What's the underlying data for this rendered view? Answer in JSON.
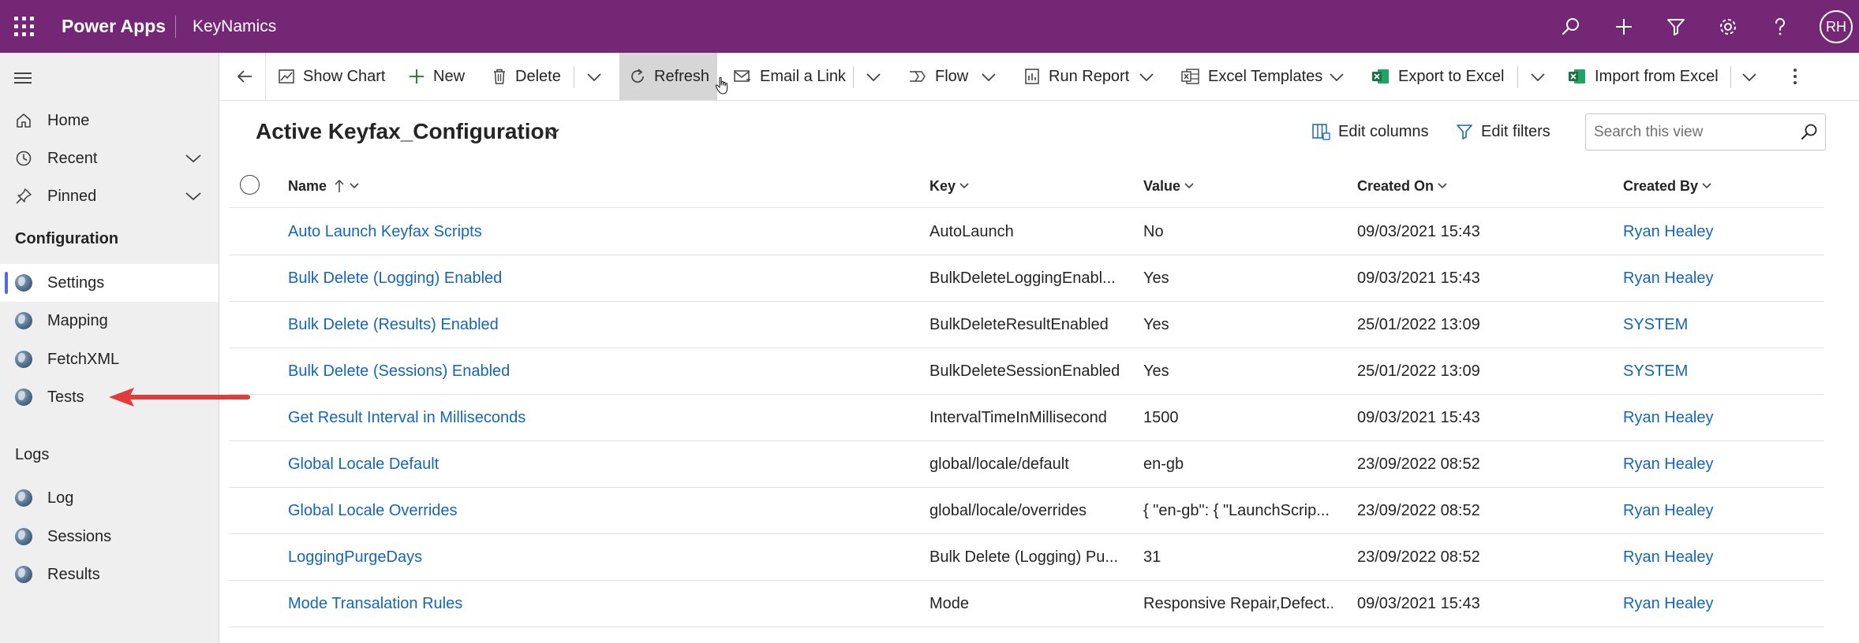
{
  "topbar": {
    "brand": "Power Apps",
    "app_name": "KeyNamics",
    "icons": [
      "search-icon",
      "plus-icon",
      "filter-icon",
      "settings-gear-icon",
      "help-icon"
    ],
    "avatar_initials": "RH"
  },
  "sidebar": {
    "items_top": [
      {
        "label": "Home",
        "icon": "home-icon"
      },
      {
        "label": "Recent",
        "icon": "clock-icon",
        "expandable": true
      },
      {
        "label": "Pinned",
        "icon": "pin-icon",
        "expandable": true
      }
    ],
    "section_configuration": "Configuration",
    "configuration_items": [
      {
        "label": "Settings",
        "icon": "entity-globe-icon",
        "active": true
      },
      {
        "label": "Mapping",
        "icon": "entity-globe-icon"
      },
      {
        "label": "FetchXML",
        "icon": "entity-globe-icon"
      },
      {
        "label": "Tests",
        "icon": "entity-globe-icon"
      }
    ],
    "section_logs": "Logs",
    "logs_items": [
      {
        "label": "Log",
        "icon": "entity-globe-icon"
      },
      {
        "label": "Sessions",
        "icon": "entity-globe-icon"
      },
      {
        "label": "Results",
        "icon": "entity-globe-icon"
      }
    ],
    "annotation_arrow_color": "#e03c3c"
  },
  "commandbar": {
    "show_chart": "Show Chart",
    "new": "New",
    "delete": "Delete",
    "refresh": "Refresh",
    "email_link": "Email a Link",
    "flow": "Flow",
    "run_report": "Run Report",
    "excel_templates": "Excel Templates",
    "export_excel": "Export to Excel",
    "import_excel": "Import from Excel"
  },
  "view": {
    "title": "Active Keyfax_Configuration",
    "edit_columns": "Edit columns",
    "edit_filters": "Edit filters",
    "search_placeholder": "Search this view"
  },
  "grid": {
    "columns": [
      "Name",
      "Key",
      "Value",
      "Created On",
      "Created By"
    ],
    "sorted_column": "Name",
    "rows": [
      {
        "name": "Auto Launch Keyfax Scripts",
        "key": "AutoLaunch",
        "value": "No",
        "created_on": "09/03/2021 15:43",
        "created_by": "Ryan Healey"
      },
      {
        "name": "Bulk Delete (Logging) Enabled",
        "key": "BulkDeleteLoggingEnabl...",
        "value": "Yes",
        "created_on": "09/03/2021 15:43",
        "created_by": "Ryan Healey"
      },
      {
        "name": "Bulk Delete (Results) Enabled",
        "key": "BulkDeleteResultEnabled",
        "value": "Yes",
        "created_on": "25/01/2022 13:09",
        "created_by": "SYSTEM"
      },
      {
        "name": "Bulk Delete (Sessions) Enabled",
        "key": "BulkDeleteSessionEnabled",
        "value": "Yes",
        "created_on": "25/01/2022 13:09",
        "created_by": "SYSTEM"
      },
      {
        "name": "Get Result Interval in Milliseconds",
        "key": "IntervalTimeInMillisecond",
        "value": "1500",
        "created_on": "09/03/2021 15:43",
        "created_by": "Ryan Healey"
      },
      {
        "name": "Global Locale Default",
        "key": "global/locale/default",
        "value": "en-gb",
        "created_on": "23/09/2022 08:52",
        "created_by": "Ryan Healey"
      },
      {
        "name": "Global Locale Overrides",
        "key": "global/locale/overrides",
        "value": "{ \"en-gb\": { \"LaunchScrip...",
        "created_on": "23/09/2022 08:52",
        "created_by": "Ryan Healey"
      },
      {
        "name": "LoggingPurgeDays",
        "key": "Bulk Delete (Logging) Pu...",
        "value": "31",
        "created_on": "23/09/2022 08:52",
        "created_by": "Ryan Healey"
      },
      {
        "name": "Mode Transalation Rules",
        "key": "Mode",
        "value": "Responsive Repair,Defect...",
        "created_on": "09/03/2021 15:43",
        "created_by": "Ryan Healey"
      }
    ]
  },
  "colors": {
    "topbar_bg": "#742774",
    "link": "#1466b8",
    "active_indicator": "#4f6bed",
    "sidebar_bg": "#efefef",
    "excel_green": "#1d7044"
  }
}
